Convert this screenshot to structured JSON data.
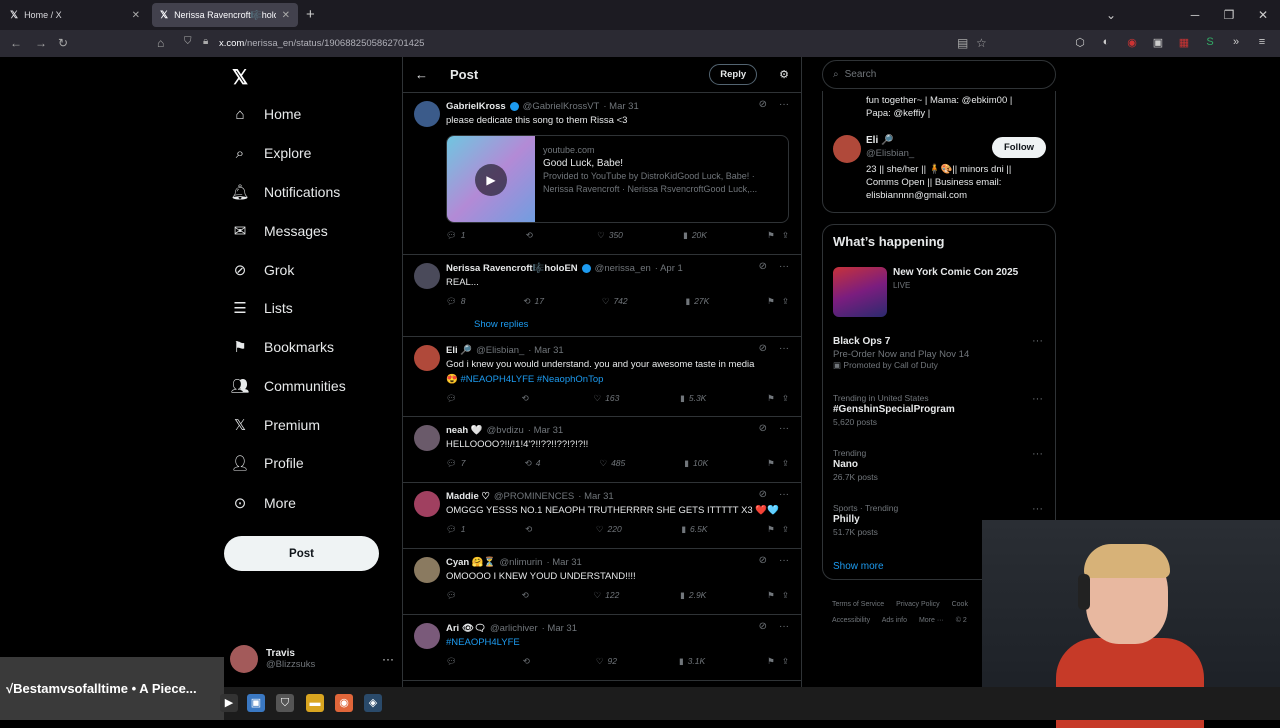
{
  "browser": {
    "tabs": [
      {
        "title": "Home / X"
      },
      {
        "title": "Nerissa Ravencroft🎼holoEN on X"
      }
    ],
    "url_host": "x.com",
    "url_path": "/nerissa_en/status/1906882505862701425"
  },
  "nav": {
    "items": [
      {
        "label": "Home",
        "icon": "home-icon"
      },
      {
        "label": "Explore",
        "icon": "search-icon"
      },
      {
        "label": "Notifications",
        "icon": "bell-icon"
      },
      {
        "label": "Messages",
        "icon": "mail-icon"
      },
      {
        "label": "Grok",
        "icon": "grok-icon"
      },
      {
        "label": "Lists",
        "icon": "list-icon"
      },
      {
        "label": "Bookmarks",
        "icon": "bookmark-icon"
      },
      {
        "label": "Communities",
        "icon": "people-icon"
      },
      {
        "label": "Premium",
        "icon": "x-icon"
      },
      {
        "label": "Profile",
        "icon": "person-icon"
      },
      {
        "label": "More",
        "icon": "more-circle-icon"
      }
    ],
    "post_label": "Post",
    "account": {
      "name": "Travis",
      "handle": "@Blizzsuks"
    }
  },
  "header": {
    "title": "Post",
    "reply_label": "Reply"
  },
  "tweets": [
    {
      "name": "GabrielKross",
      "handle": "@GabrielKrossVT",
      "date": "· Mar 31",
      "text": "please dedicate this song to them Rissa <3",
      "card": {
        "domain": "youtube.com",
        "title": "Good Luck, Babe!",
        "desc1": "Provided to YouTube by DistroKidGood Luck, Babe! ·",
        "desc2": "Nerissa Ravencroft · Nerissa RsvencroftGood Luck,..."
      },
      "replies": "1",
      "retweets": "",
      "likes": "350",
      "views": "20K",
      "color": "#3b5b8a"
    },
    {
      "name": "Nerissa Ravencroft🎼holoEN",
      "handle": "@nerissa_en",
      "date": "· Apr 1",
      "text": "REAL...",
      "replies": "8",
      "retweets": "17",
      "likes": "742",
      "views": "27K",
      "color": "#4a4a5a"
    },
    {
      "name": "Eli 🔎",
      "handle": "@Elisbian_",
      "date": "· Mar 31",
      "text": "God i knew you would understand. you and your awesome taste in media",
      "hashtags": "😍 #NEAOPH4LYFE #NeaophOnTop",
      "replies": "",
      "retweets": "",
      "likes": "163",
      "views": "5.3K",
      "color": "#b0493a"
    },
    {
      "name": "neah 🤍",
      "handle": "@bvdizu",
      "date": "· Mar 31",
      "text": "HELLOOOO?!!/!1!4'?!!??!!??!?!?!!",
      "replies": "7",
      "retweets": "4",
      "likes": "485",
      "views": "10K",
      "color": "#6a5a6a"
    },
    {
      "name": "Maddie ♡",
      "handle": "@PROMINENCES",
      "date": "· Mar 31",
      "text": "OMGGG YESSS NO.1 NEAOPH TRUTHERRRR SHE GETS ITTTTT X3 ❤️🩵",
      "replies": "1",
      "retweets": "",
      "likes": "220",
      "views": "6.5K",
      "color": "#a04060"
    },
    {
      "name": "Cyan 🤗⏳",
      "handle": "@nlimurin",
      "date": "· Mar 31",
      "text": "OMOOOO I KNEW YOUD UNDERSTAND!!!!",
      "replies": "",
      "retweets": "",
      "likes": "122",
      "views": "2.9K",
      "color": "#8a7a60"
    },
    {
      "name": "Ari 👁🗨",
      "handle": "@arlichiver",
      "date": "· Mar 31",
      "hashtags": "#NEAOPH4LYFE",
      "replies": "",
      "retweets": "",
      "likes": "92",
      "views": "3.1K",
      "color": "#7a5a7a"
    }
  ],
  "show_replies": "Show replies",
  "right": {
    "search_placeholder": "Search",
    "bio_top": "fun together~ | Mama: @ebkim00 |",
    "bio_top2": "Papa: @keffiy |",
    "eli": {
      "name": "Eli 🔎",
      "handle": "@Elisbian_",
      "follow": "Follow",
      "bio": "23 || she/her || 🧍🎨|| minors dni || Comms Open || Business email: elisbiannnn@gmail.com"
    },
    "happening_title": "What’s happening",
    "nycc": {
      "name": "New York Comic Con 2025",
      "meta": "LIVE"
    },
    "trends": [
      {
        "meta": "",
        "name": "Black Ops 7",
        "sub": "Pre-Order Now and Play Nov 14",
        "promo": "Promoted by Call of Duty"
      },
      {
        "meta": "Trending in United States",
        "name": "#GenshinSpecialProgram",
        "sub": "5,620 posts"
      },
      {
        "meta": "Trending",
        "name": "Nano",
        "sub": "26.7K posts"
      },
      {
        "meta": "Sports · Trending",
        "name": "Philly",
        "sub": "51.7K posts"
      }
    ],
    "show_more": "Show more",
    "footer": [
      "Terms of Service",
      "Privacy Policy",
      "Cook",
      "Accessibility",
      "Ads info",
      "More ···",
      "© 2"
    ]
  },
  "taskbar": {
    "now_playing": "√Bestamvsofalltime • A Piece..."
  }
}
